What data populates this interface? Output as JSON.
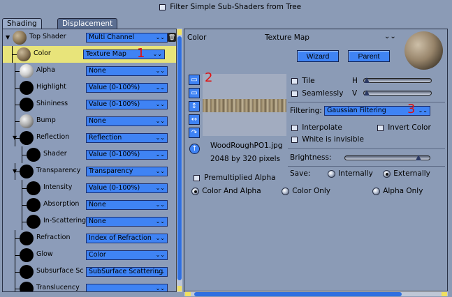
{
  "top_filter": {
    "label": "Filter Simple Sub-Shaders from Tree",
    "checked": false
  },
  "tabs": [
    {
      "label": "Shading",
      "active": true
    },
    {
      "label": "Displacement",
      "active": false
    }
  ],
  "tree": [
    {
      "label": "Top Shader",
      "value": "Multi Channel",
      "sphere": "texture",
      "indent": 0,
      "expander": true,
      "selected": false
    },
    {
      "label": "Color",
      "value": "Texture Map",
      "sphere": "texture",
      "indent": 1,
      "expander": false,
      "selected": true
    },
    {
      "label": "Alpha",
      "value": "None",
      "sphere": "white",
      "indent": 1,
      "expander": false,
      "selected": false
    },
    {
      "label": "Highlight",
      "value": "Value (0-100%)",
      "sphere": "black",
      "indent": 1,
      "expander": false,
      "selected": false
    },
    {
      "label": "Shininess",
      "value": "Value (0-100%)",
      "sphere": "black",
      "indent": 1,
      "expander": false,
      "selected": false
    },
    {
      "label": "Bump",
      "value": "None",
      "sphere": "bump",
      "indent": 1,
      "expander": false,
      "selected": false
    },
    {
      "label": "Reflection",
      "value": "Reflection",
      "sphere": "black",
      "indent": 1,
      "expander": true,
      "selected": false
    },
    {
      "label": "Shader",
      "value": "Value (0-100%)",
      "sphere": "black",
      "indent": 2,
      "expander": false,
      "selected": false
    },
    {
      "label": "Transparency",
      "value": "Transparency",
      "sphere": "black",
      "indent": 1,
      "expander": true,
      "selected": false
    },
    {
      "label": "Intensity",
      "value": "Value (0-100%)",
      "sphere": "black",
      "indent": 2,
      "expander": false,
      "selected": false
    },
    {
      "label": "Absorption",
      "value": "None",
      "sphere": "black",
      "indent": 2,
      "expander": false,
      "selected": false
    },
    {
      "label": "In-Scattering",
      "value": "None",
      "sphere": "black",
      "indent": 2,
      "expander": false,
      "selected": false
    },
    {
      "label": "Refraction",
      "value": "Index of Refraction",
      "sphere": "black",
      "indent": 1,
      "expander": false,
      "selected": false
    },
    {
      "label": "Glow",
      "value": "Color",
      "sphere": "black",
      "indent": 1,
      "expander": false,
      "selected": false
    },
    {
      "label": "Subsurface Sc",
      "value": "SubSurface Scattering",
      "sphere": "black",
      "indent": 1,
      "expander": false,
      "selected": false
    },
    {
      "label": "Translucency",
      "value": "",
      "sphere": "black",
      "indent": 1,
      "expander": false,
      "selected": false
    }
  ],
  "right_header": {
    "channel": "Color",
    "type": "Texture Map",
    "collapse_icon": "double-chevron-down-icon"
  },
  "buttons": {
    "wizard": "Wizard",
    "parent": "Parent"
  },
  "texture": {
    "filename": "WoodRoughPO1.jpg",
    "size": "2048 by 320 pixels"
  },
  "options": {
    "tile": "Tile",
    "seamlessly": "Seamlessly",
    "h": "H",
    "v": "V",
    "filtering_label": "Filtering:",
    "filtering_value": "Gaussian Filtering",
    "interpolate": "Interpolate",
    "invert_color": "Invert Color",
    "white_invisible": "White is invisible",
    "brightness": "Brightness:",
    "save": "Save:",
    "internally": "Internally",
    "externally": "Externally",
    "premultiplied": "Premultiplied Alpha",
    "color_and_alpha": "Color And Alpha",
    "color_only": "Color Only",
    "alpha_only": "Alpha Only"
  },
  "sliders": {
    "h_position": 0.0,
    "v_position": 0.0,
    "brightness_position": 0.88
  },
  "annotations": [
    "1",
    "2",
    "3"
  ],
  "colors": {
    "background": "#8b9bb6",
    "accent_blue": "#3f83f4",
    "selection_yellow": "#e8e47a",
    "annotation_red": "#e01010"
  }
}
